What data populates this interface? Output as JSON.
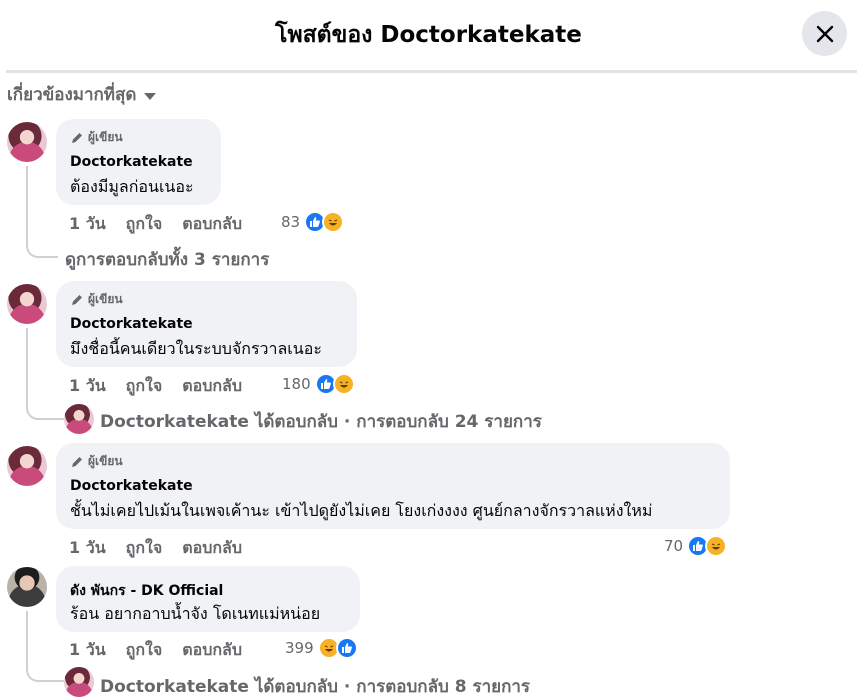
{
  "header": {
    "title": "โพสต์ของ Doctorkatekate"
  },
  "sort": {
    "label": "เกี่ยวข้องมากที่สุด"
  },
  "comments": [
    {
      "badge": "ผู้เขียน",
      "author": "Doctorkatekate",
      "text": "ต้องมีมูลก่อนเนอะ",
      "time": "1 วัน",
      "like": "ถูกใจ",
      "reply": "ตอบกลับ",
      "reaction_count": "83",
      "reactions": [
        "like",
        "haha"
      ],
      "replies": "ดูการตอบกลับทั้ง 3 รายการ"
    },
    {
      "badge": "ผู้เขียน",
      "author": "Doctorkatekate",
      "text": "มึงชื่อนี้คนเดียวในระบบจักรวาลเนอะ",
      "time": "1 วัน",
      "like": "ถูกใจ",
      "reply": "ตอบกลับ",
      "reaction_count": "180",
      "reactions": [
        "like",
        "haha"
      ],
      "replies": "Doctorkatekate ได้ตอบกลับ · การตอบกลับ 24 รายการ"
    },
    {
      "badge": "ผู้เขียน",
      "author": "Doctorkatekate",
      "text": "ชั้นไม่เคยไปเม้นในเพจเค้านะ เข้าไปดูยังไม่เคย โยงเก่งงงง ศูนย์กลางจักรวาลแห่งใหม่",
      "time": "1 วัน",
      "like": "ถูกใจ",
      "reply": "ตอบกลับ",
      "reaction_count": "70",
      "reactions": [
        "like",
        "haha"
      ]
    },
    {
      "author": "ดัง พันกร - DK Official",
      "text": "ร้อน อยากอาบน้ำจัง โดเนทแม่หน่อย",
      "time": "1 วัน",
      "like": "ถูกใจ",
      "reply": "ตอบกลับ",
      "reaction_count": "399",
      "reactions": [
        "haha",
        "like"
      ],
      "replies": "Doctorkatekate ได้ตอบกลับ · การตอบกลับ 8 รายการ"
    }
  ],
  "icons": {
    "close": "close-icon",
    "pencil": "pencil-icon",
    "caret": "caret-down-icon",
    "like": "like-reaction-icon",
    "haha": "haha-reaction-icon"
  },
  "colors": {
    "like_blue": "#1877f2",
    "haha_yellow": "#f7b125",
    "secondary_text": "#65676b",
    "bubble_bg": "#f0f2f5"
  }
}
